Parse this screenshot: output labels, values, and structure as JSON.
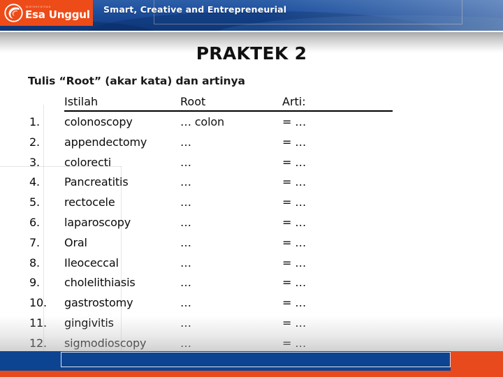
{
  "header": {
    "logo_university": "Universitas",
    "logo_name": "Esa Unggul",
    "tagline": "Smart, Creative and Entrepreneurial",
    "orange": "#ed4b18",
    "blue": "#1d4f9e"
  },
  "slide": {
    "title": "PRAKTEK  2",
    "subtitle": "Tulis “Root” (akar kata) dan artinya"
  },
  "table": {
    "headers": {
      "num": "",
      "term": "Istilah",
      "root": "Root",
      "arti": "Arti:"
    },
    "rows": [
      {
        "num": "1.",
        "term": "colonoscopy",
        "root": "… colon",
        "arti": "= …"
      },
      {
        "num": "2.",
        "term": "appendectomy",
        "root": "…",
        "arti": "= …"
      },
      {
        "num": "3.",
        "term": "colorecti",
        "root": "…",
        "arti": "= …"
      },
      {
        "num": "4.",
        "term": "Pancreatitis",
        "root": "…",
        "arti": "= …"
      },
      {
        "num": "5.",
        "term": "rectocele",
        "root": "…",
        "arti": "= …"
      },
      {
        "num": "6.",
        "term": "laparoscopy",
        "root": "…",
        "arti": "= …"
      },
      {
        "num": "7.",
        "term": "Oral",
        "root": "…",
        "arti": "= …"
      },
      {
        "num": "8.",
        "term": "Ileoceccal",
        "root": "…",
        "arti": "= …"
      },
      {
        "num": "9.",
        "term": "cholelithiasis",
        "root": "…",
        "arti": "= …"
      },
      {
        "num": "10.",
        "term": "gastrostomy",
        "root": "…",
        "arti": "= …"
      },
      {
        "num": "11.",
        "term": "gingivitis",
        "root": "…",
        "arti": "= …"
      },
      {
        "num": "12.",
        "term": "sigmodioscopy",
        "root": "…",
        "arti": "= …"
      }
    ]
  },
  "footer": {
    "blue": "#0d4491",
    "orange": "#e8491d"
  }
}
